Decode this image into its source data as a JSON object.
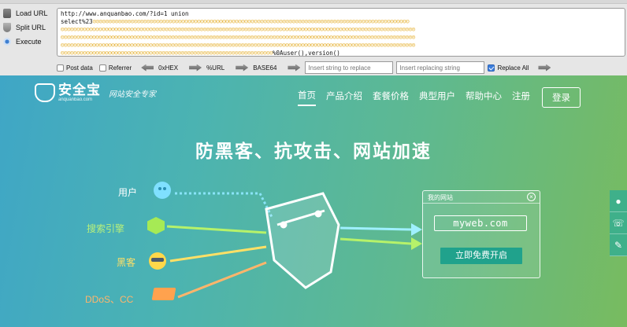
{
  "hackbar": {
    "actions": [
      {
        "label": "Load URL",
        "icon": "load-url-icon"
      },
      {
        "label": "Split URL",
        "icon": "split-url-icon"
      },
      {
        "label": "Execute",
        "icon": "execute-icon"
      }
    ],
    "url_lines": {
      "line1": "http://www.anquanbao.com/?id=1 union",
      "line2_prefix": "select%23",
      "line_last_suffix": "%0Auser(),version()"
    },
    "options": {
      "post_data": "Post data",
      "referrer": "Referrer",
      "hex": "0xHEX",
      "url": "%URL",
      "base64": "BASE64",
      "replace_placeholder": "Insert string to replace",
      "replacing_placeholder": "Insert replacing string",
      "replace_all": "Replace All",
      "replace_all_checked": true
    }
  },
  "site": {
    "brand_name": "安全宝",
    "brand_domain": "anquanbao.com",
    "tagline": "网站安全专家",
    "nav": [
      "首页",
      "产品介绍",
      "套餐价格",
      "典型用户",
      "帮助中心",
      "注册"
    ],
    "login": "登录",
    "headline": "防黑客、抗攻击、网站加速",
    "labels": {
      "user": "用户",
      "search": "搜索引擎",
      "hacker": "黑客",
      "ddos": "DDoS、CC"
    },
    "mysite": {
      "title": "我的网站",
      "domain": "myweb.com",
      "cta": "立即免费开启"
    },
    "colors": {
      "user": "#7fe0ff",
      "search": "#a6ea55",
      "hacker": "#ffd84a",
      "ddos": "#ffa24e",
      "cta": "#20a28c"
    }
  }
}
